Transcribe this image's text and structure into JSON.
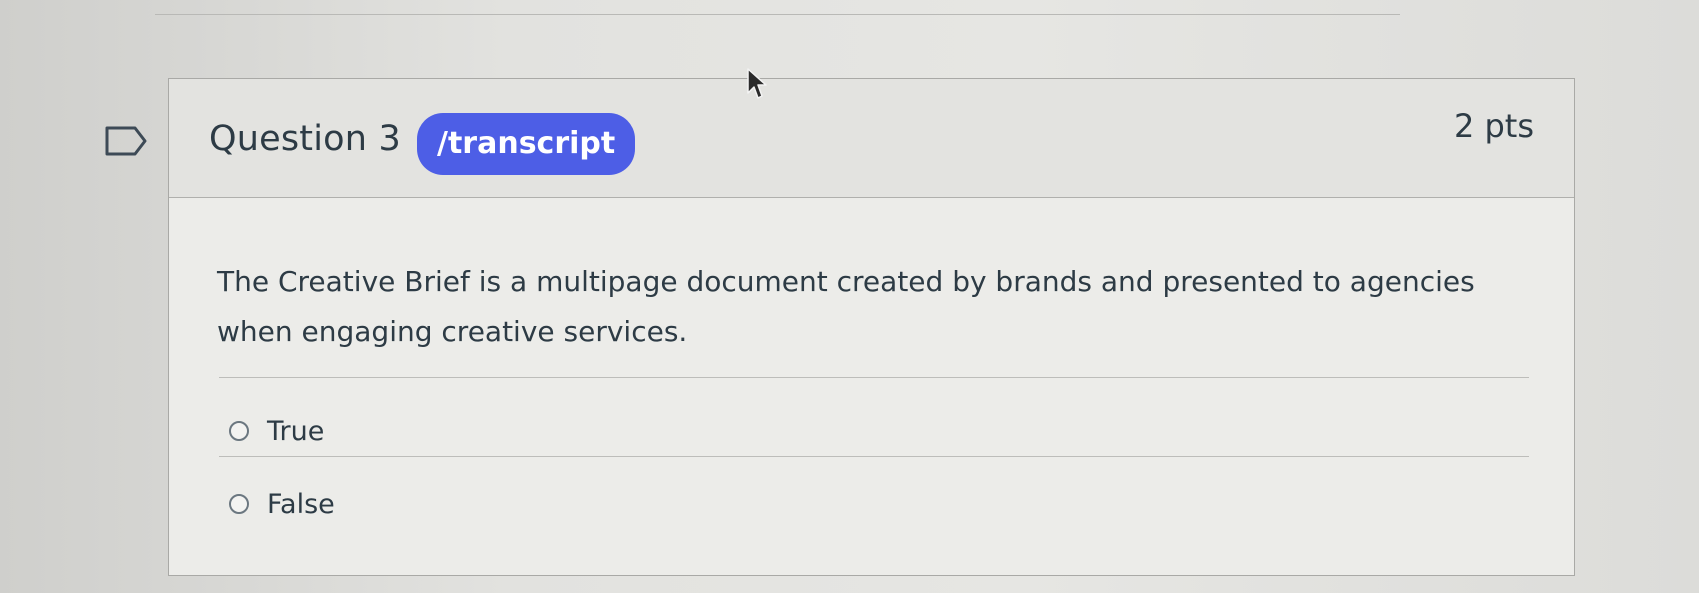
{
  "question": {
    "title": "Question 3",
    "badge": "/transcript",
    "points": "2 pts",
    "text": "The Creative Brief is a multipage document created by brands and presented to agencies when engaging creative services."
  },
  "answers": [
    {
      "label": "True"
    },
    {
      "label": "False"
    }
  ],
  "colors": {
    "badge": "#4d5ee6",
    "text": "#2d3b45"
  },
  "icons": {
    "flag": "flag-icon",
    "cursor": "cursor-icon"
  }
}
